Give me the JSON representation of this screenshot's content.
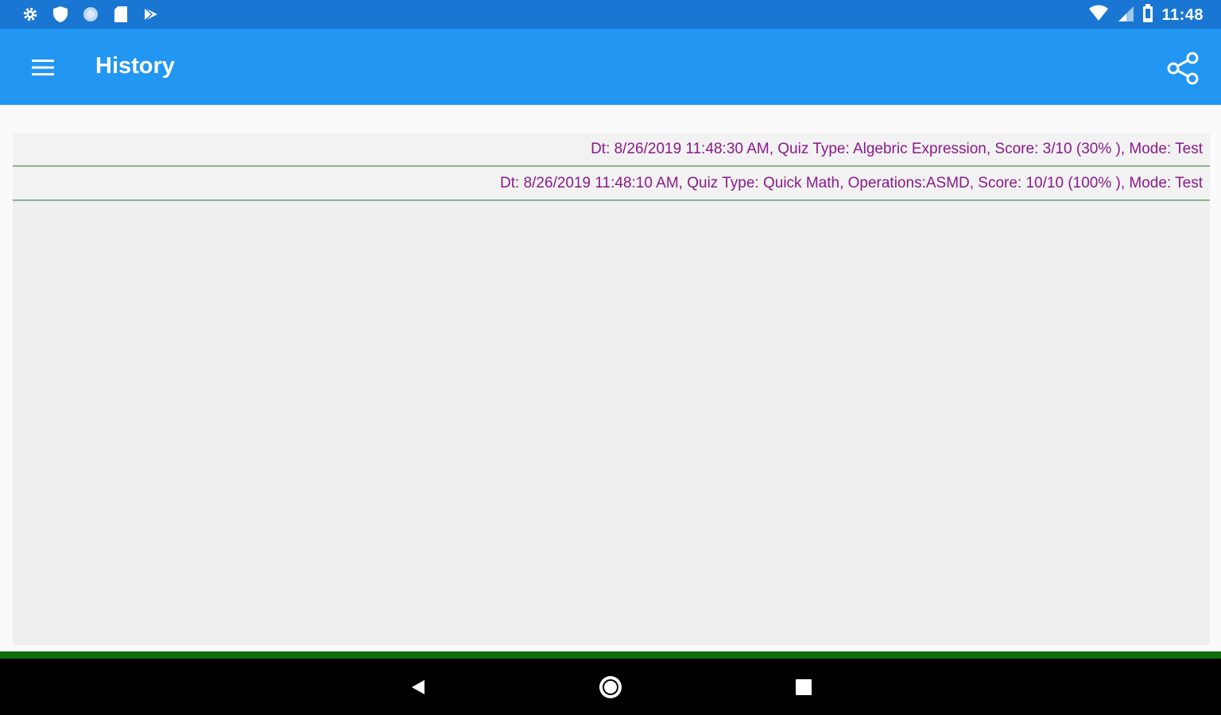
{
  "status_bar": {
    "left_icons": [
      "settings-icon",
      "shield-icon",
      "circle-icon",
      "sd-card-icon",
      "play-store-icon"
    ],
    "right_icons": [
      "wifi-icon",
      "cell-signal-icon",
      "battery-icon"
    ],
    "time": "11:48"
  },
  "app_bar": {
    "menu_icon": "hamburger-menu-icon",
    "title": "History",
    "share_icon": "share-icon"
  },
  "history": {
    "items": [
      {
        "text": "Dt: 8/26/2019 11:48:30 AM, Quiz Type: Algebric Expression, Score: 3/10 (30% ), Mode: Test"
      },
      {
        "text": "Dt: 8/26/2019 11:48:10 AM, Quiz Type: Quick Math, Operations:ASMD, Score: 10/10 (100% ), Mode: Test"
      }
    ]
  },
  "nav_bar": {
    "icons": [
      "back-icon",
      "home-icon",
      "recents-icon"
    ]
  },
  "colors": {
    "status_bar": "#1976d2",
    "app_bar": "#2196f3",
    "row_text": "#8b1a8b",
    "row_divider": "#8fb08f",
    "bottom_line": "#0c6f0c"
  }
}
